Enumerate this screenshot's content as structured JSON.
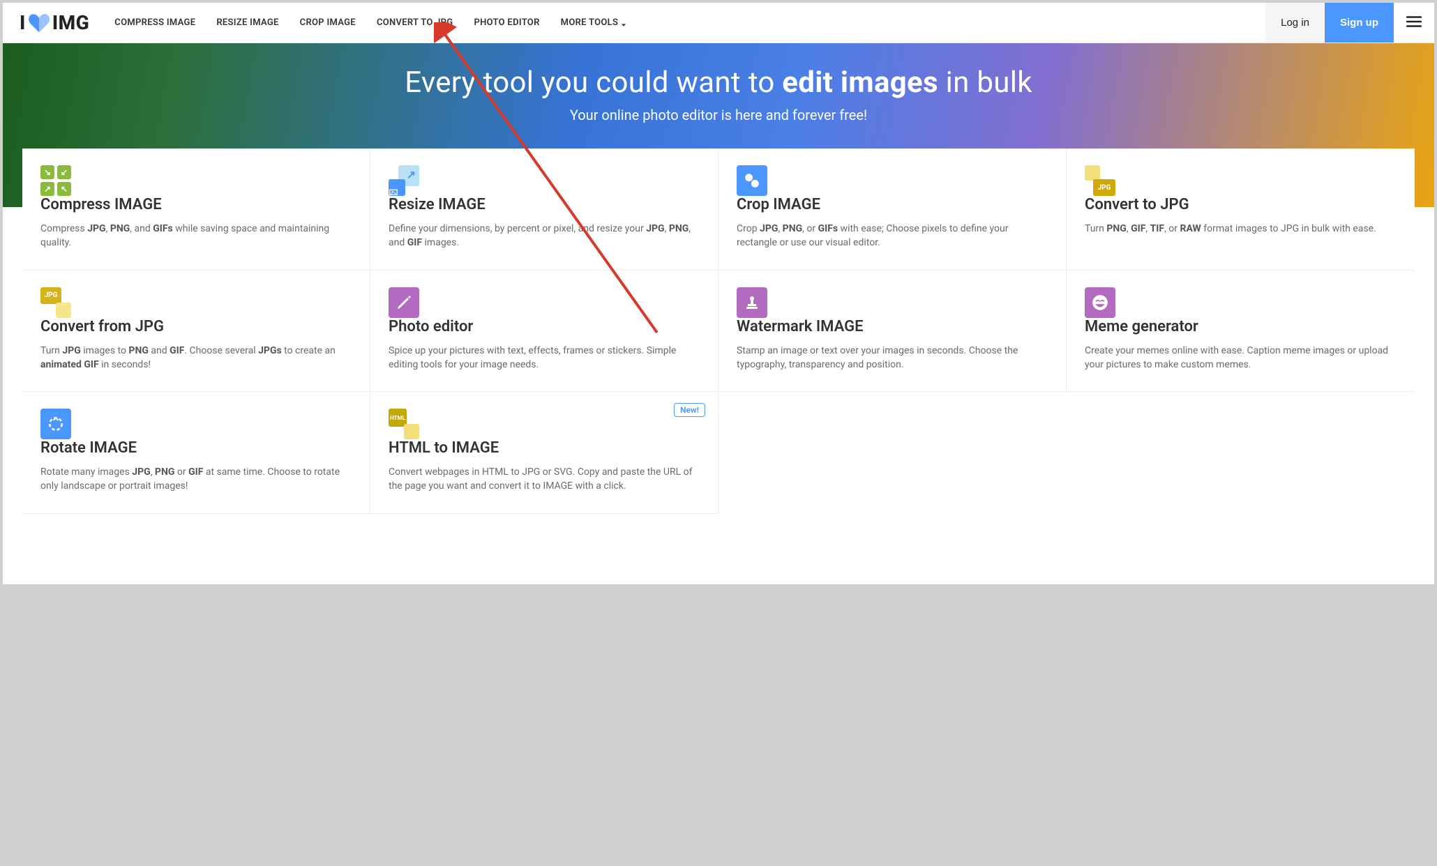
{
  "logo": {
    "prefix": "I",
    "suffix": "IMG"
  },
  "nav": {
    "items": [
      {
        "label": "COMPRESS IMAGE"
      },
      {
        "label": "RESIZE IMAGE"
      },
      {
        "label": "CROP IMAGE"
      },
      {
        "label": "CONVERT TO JPG"
      },
      {
        "label": "PHOTO EDITOR"
      },
      {
        "label": "MORE TOOLS"
      }
    ],
    "login": "Log in",
    "signup": "Sign up"
  },
  "hero": {
    "title_plain1": "Every tool you could want to ",
    "title_bold": "edit images",
    "title_plain2": " in bulk",
    "subtitle": "Your online photo editor is here and forever free!"
  },
  "cards": [
    {
      "title": "Compress IMAGE",
      "desc_html": "Compress <b>JPG</b>, <b>PNG</b>, and <b>GIFs</b> while saving space and maintaining quality."
    },
    {
      "title": "Resize IMAGE",
      "desc_html": "Define your dimensions, by percent or pixel, and resize your <b>JPG</b>, <b>PNG</b>, and <b>GIF</b> images."
    },
    {
      "title": "Crop IMAGE",
      "desc_html": "Crop <b>JPG</b>, <b>PNG</b>, or <b>GIFs</b> with ease; Choose pixels to define your rectangle or use our visual editor."
    },
    {
      "title": "Convert to JPG",
      "desc_html": "Turn <b>PNG</b>, <b>GIF</b>, <b>TIF</b>, or <b>RAW</b> format images to JPG in bulk with ease."
    },
    {
      "title": "Convert from JPG",
      "desc_html": "Turn <b>JPG</b> images to <b>PNG</b> and <b>GIF</b>. Choose several <b>JPGs</b> to create an <b>animated GIF</b> in seconds!"
    },
    {
      "title": "Photo editor",
      "desc_html": "Spice up your pictures with text, effects, frames or stickers. Simple editing tools for your image needs."
    },
    {
      "title": "Watermark IMAGE",
      "desc_html": "Stamp an image or text over your images in seconds. Choose the typography, transparency and position."
    },
    {
      "title": "Meme generator",
      "desc_html": "Create your memes online with ease. Caption meme images or upload your pictures to make custom memes."
    },
    {
      "title": "Rotate IMAGE",
      "desc_html": "Rotate many images <b>JPG</b>, <b>PNG</b> or <b>GIF</b> at same time. Choose to rotate only landscape or portrait images!"
    },
    {
      "title": "HTML to IMAGE",
      "badge": "New!",
      "desc_html": "Convert webpages in HTML to JPG or SVG. Copy and paste the URL of the page you want and convert it to IMAGE with a click."
    }
  ]
}
